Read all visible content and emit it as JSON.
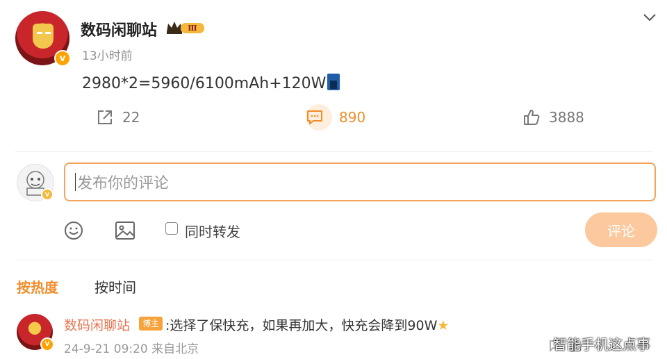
{
  "post": {
    "username": "数码闲聊站",
    "crown_level": "Ⅲ",
    "time": "13小时前",
    "content": "2980*2=5960/6100mAh+120W",
    "battery_icon": "battery-icon",
    "actions": {
      "repost_count": "22",
      "comment_count": "890",
      "like_count": "3888"
    }
  },
  "composer": {
    "placeholder": "发布你的评论",
    "repost_label": "同时转发",
    "submit_label": "评论"
  },
  "sort": {
    "hot_label": "按热度",
    "time_label": "按时间"
  },
  "comment": {
    "username": "数码闲聊站",
    "tag": "博主",
    "text": ":选择了保快充，如果再加大，快充会降到90W",
    "meta": "24-9-21 09:20 来自北京"
  },
  "watermark": "智能手机这点事",
  "colors": {
    "accent": "#f28c28",
    "comment_user": "#eb7350",
    "verified": "#ffa200",
    "button_disabled": "#fbc99d"
  }
}
